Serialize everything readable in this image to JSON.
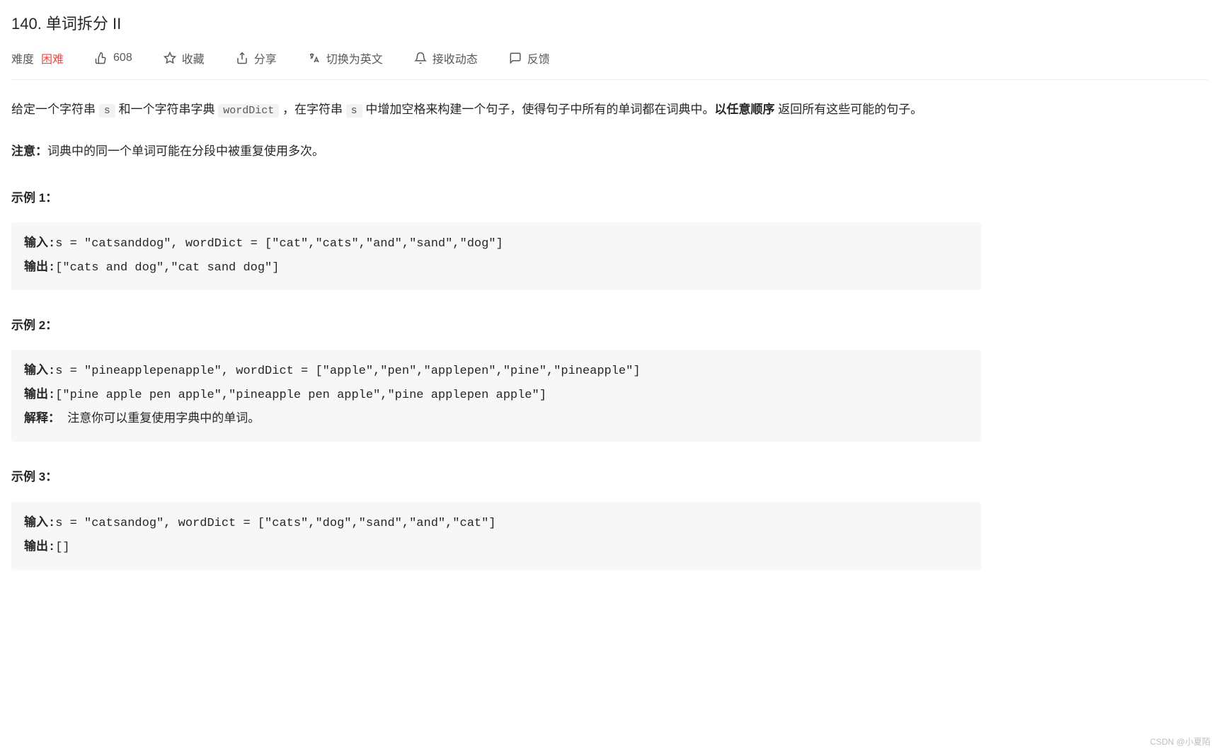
{
  "title": "140. 单词拆分 II",
  "toolbar": {
    "difficulty_label": "难度",
    "difficulty_value": "困难",
    "likes": "608",
    "favorite": "收藏",
    "share": "分享",
    "translate": "切换为英文",
    "subscribe": "接收动态",
    "feedback": "反馈"
  },
  "desc": {
    "p1_a": "给定一个字符串 ",
    "code_s1": "s",
    "p1_b": " 和一个字符串字典 ",
    "code_worddict": "wordDict",
    "p1_c": " ，在字符串 ",
    "code_s2": "s",
    "p1_d": " 中增加空格来构建一个句子，使得句子中所有的单词都在词典中。",
    "p1_bold": "以任意顺序",
    "p1_e": " 返回所有这些可能的句子。",
    "p2_bold": "注意：",
    "p2_text": "词典中的同一个单词可能在分段中被重复使用多次。"
  },
  "examples": [
    {
      "label": "示例 1：",
      "lines": [
        {
          "label": "输入:",
          "text": "s = \"catsanddog\", wordDict = [\"cat\",\"cats\",\"and\",\"sand\",\"dog\"]"
        },
        {
          "label": "输出:",
          "text": "[\"cats and dog\",\"cat sand dog\"]"
        }
      ]
    },
    {
      "label": "示例 2：",
      "lines": [
        {
          "label": "输入:",
          "text": "s = \"pineapplepenapple\", wordDict = [\"apple\",\"pen\",\"applepen\",\"pine\",\"pineapple\"]"
        },
        {
          "label": "输出:",
          "text": "[\"pine apple pen apple\",\"pineapple pen apple\",\"pine applepen apple\"]"
        },
        {
          "label": "解释：",
          "text": " 注意你可以重复使用字典中的单词。"
        }
      ]
    },
    {
      "label": "示例 3：",
      "lines": [
        {
          "label": "输入:",
          "text": "s = \"catsandog\", wordDict = [\"cats\",\"dog\",\"sand\",\"and\",\"cat\"]"
        },
        {
          "label": "输出:",
          "text": "[]"
        }
      ]
    }
  ],
  "watermark": "CSDN @小夏陌"
}
